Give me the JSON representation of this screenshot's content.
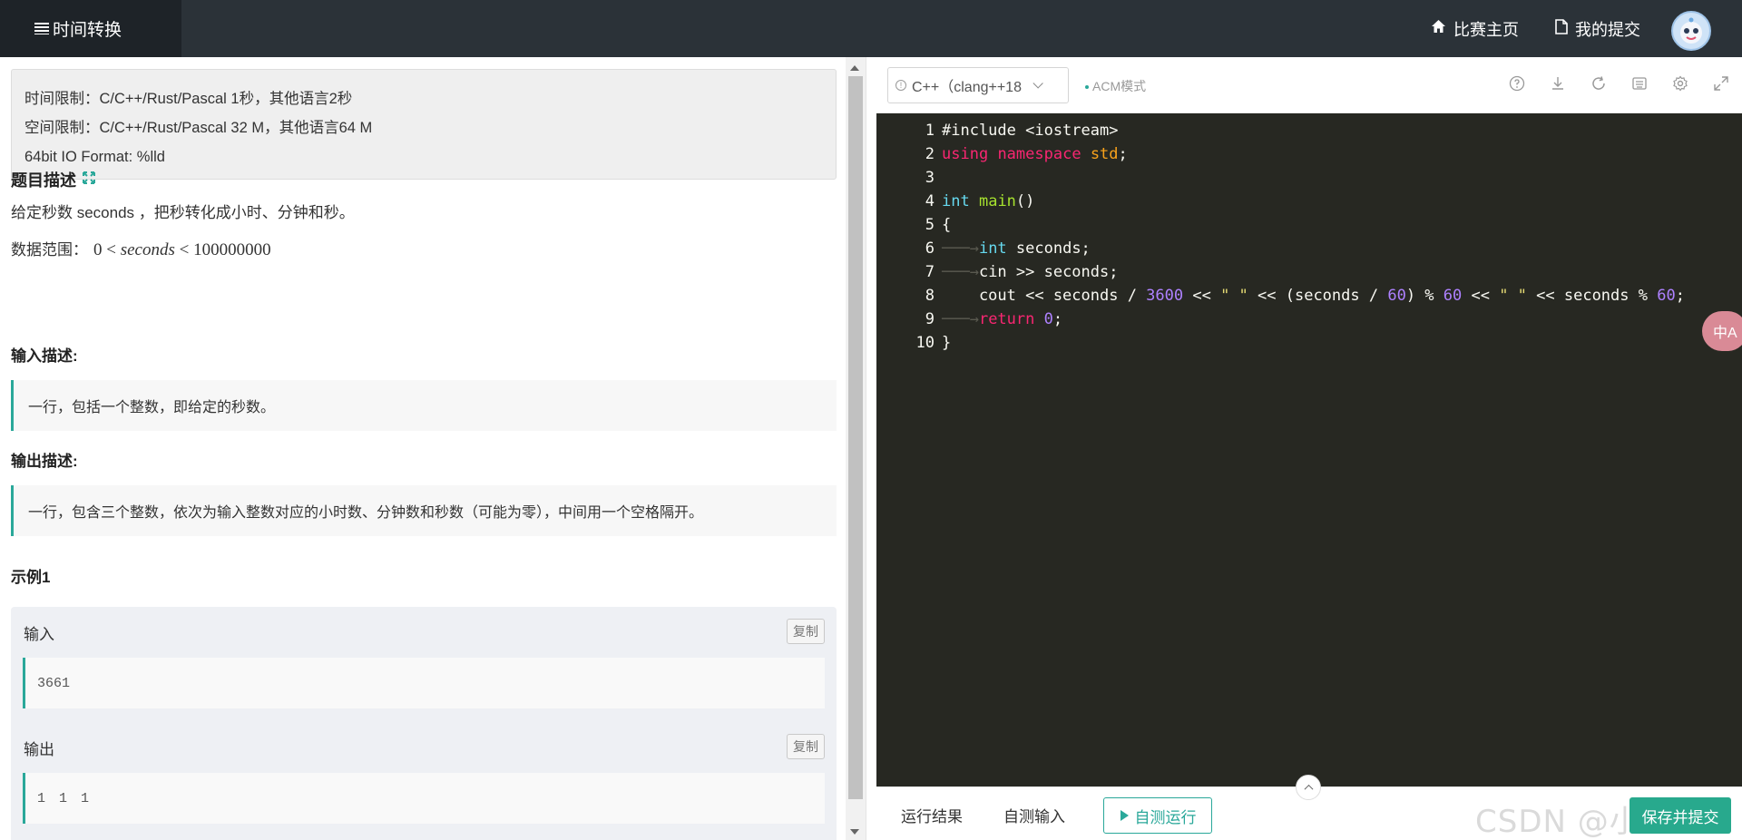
{
  "header": {
    "title": "时间转换",
    "nav": [
      {
        "label": "比赛主页",
        "icon": "home-icon"
      },
      {
        "label": "我的提交",
        "icon": "file-icon"
      }
    ]
  },
  "problem": {
    "limits": {
      "time": "时间限制：C/C++/Rust/Pascal 1秒，其他语言2秒",
      "memory": "空间限制：C/C++/Rust/Pascal 32 M，其他语言64 M",
      "io_format": "64bit IO Format: %lld"
    },
    "description_title": "题目描述",
    "description": "给定秒数 seconds ，把秒转化成小时、分钟和秒。",
    "range_label": "数据范围：",
    "range": {
      "low": "0",
      "var": "seconds",
      "high": "100000000"
    },
    "input_title": "输入描述:",
    "input_desc": "一行，包括一个整数，即给定的秒数。",
    "output_title": "输出描述:",
    "output_desc": "一行，包含三个整数，依次为输入整数对应的小时数、分钟数和秒数（可能为零），中间用一个空格隔开。",
    "example_title": "示例1",
    "example": {
      "input_label": "输入",
      "input": "3661",
      "output_label": "输出",
      "output": "1 1 1",
      "copy_label": "复制"
    }
  },
  "editor": {
    "language": "C++（clang++18",
    "mode": "ACM模式",
    "tools": [
      "help-icon",
      "download-icon",
      "refresh-icon",
      "keyboard-icon",
      "settings-icon",
      "fullscreen-icon"
    ],
    "translate_label": "中A",
    "line_numbers": [
      "1",
      "2",
      "3",
      "4",
      "5",
      "6",
      "7",
      "8",
      "9",
      "10"
    ]
  },
  "bottom": {
    "tab_result": "运行结果",
    "tab_custom_input": "自测输入",
    "run_label": "自测运行",
    "watermark": "CSDN @小",
    "save_label": "保存并提交"
  },
  "colors": {
    "topbar": "#2b3238",
    "accent": "#2aa89a",
    "editor_bg": "#272822",
    "save_btn": "#28a98d"
  }
}
